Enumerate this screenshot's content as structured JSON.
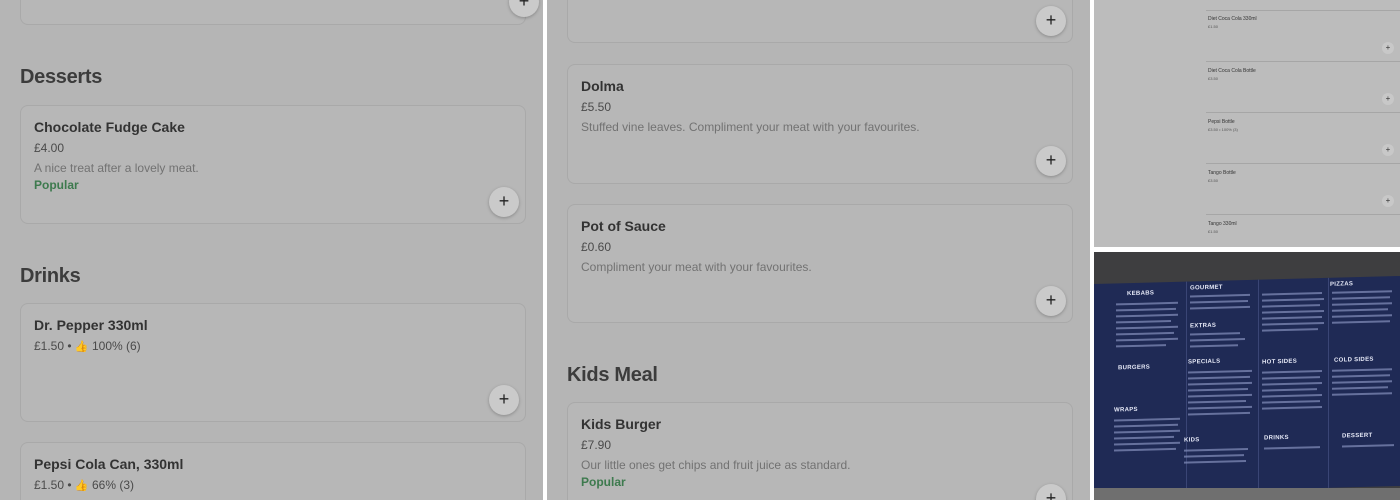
{
  "panel1": {
    "sections": [
      {
        "title": "Desserts"
      },
      {
        "title": "Drinks"
      }
    ],
    "items": [
      {
        "name": "Chocolate Fudge Cake",
        "price": "£4.00",
        "desc": "A nice treat after a lovely meat.",
        "badge": "Popular"
      },
      {
        "name": "Dr. Pepper 330ml",
        "price": "£1.50",
        "rating": "100% (6)"
      },
      {
        "name": "Pepsi Cola Can, 330ml",
        "price": "£1.50",
        "rating": "66% (3)"
      }
    ]
  },
  "panel2": {
    "sections": [
      {
        "title": "Kids Meal"
      }
    ],
    "items": [
      {
        "name": "Dolma",
        "price": "£5.50",
        "desc": "Stuffed vine leaves. Compliment your meat with your favourites."
      },
      {
        "name": "Pot of Sauce",
        "price": "£0.60",
        "desc": "Compliment your meat with your favourites."
      },
      {
        "name": "Kids Burger",
        "price": "£7.90",
        "desc": "Our little ones get chips and fruit juice as standard.",
        "badge": "Popular"
      }
    ]
  },
  "panel3": {
    "items": [
      {
        "name": "Diet Coca Cola 330ml",
        "price": "£1.50"
      },
      {
        "name": "Diet Coca Cola Bottle",
        "price": "£3.50"
      },
      {
        "name": "Pepsi Bottle",
        "price": "£3.50 • 100% (3)"
      },
      {
        "name": "Tango Bottle",
        "price": "£3.50"
      },
      {
        "name": "Tango 330ml",
        "price": "£1.50"
      }
    ]
  },
  "menu_photo": {
    "headings": [
      "KEBABS",
      "GOURMET",
      "PIZZAS",
      "EXTRAS",
      "BURGERS",
      "SPECIALS",
      "HOT SIDES",
      "COLD SIDES",
      "WRAPS",
      "KIDS",
      "DRINKS",
      "DESSERT"
    ]
  },
  "add_symbol": "+",
  "rating_separator": "•",
  "thumb_icon": "👍",
  "colors": {
    "page_bg": "#b5b5b5",
    "popular_badge": "#3d7a4e",
    "menu_board": "#1f2a55"
  }
}
